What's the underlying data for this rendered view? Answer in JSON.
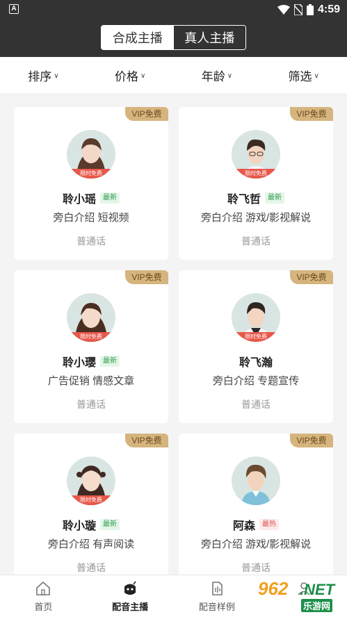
{
  "statusbar": {
    "time": "4:59"
  },
  "header": {
    "tabs": [
      {
        "label": "合成主播",
        "selected": true
      },
      {
        "label": "真人主播",
        "selected": false
      }
    ]
  },
  "filters": [
    {
      "label": "排序"
    },
    {
      "label": "价格"
    },
    {
      "label": "年龄"
    },
    {
      "label": "筛选"
    }
  ],
  "cards": [
    {
      "vip": "VIP免费",
      "avatar_tag": "限时免费",
      "name": "聆小瑶",
      "badge": "最新",
      "badge_type": "new",
      "tags": "旁白介绍 短视频",
      "lang": "普通话"
    },
    {
      "vip": "VIP免费",
      "avatar_tag": "限时免费",
      "name": "聆飞哲",
      "badge": "最新",
      "badge_type": "new",
      "tags": "旁白介绍 游戏/影视解说",
      "lang": "普通话"
    },
    {
      "vip": "VIP免费",
      "avatar_tag": "限时免费",
      "name": "聆小璎",
      "badge": "最新",
      "badge_type": "new",
      "tags": "广告促销 情感文章",
      "lang": "普通话"
    },
    {
      "vip": "VIP免费",
      "avatar_tag": "限时免费",
      "name": "聆飞瀚",
      "badge": "",
      "badge_type": "",
      "tags": "旁白介绍 专题宣传",
      "lang": "普通话"
    },
    {
      "vip": "VIP免费",
      "avatar_tag": "限时免费",
      "name": "聆小璇",
      "badge": "最新",
      "badge_type": "new",
      "tags": "旁白介绍 有声阅读",
      "lang": "普通话"
    },
    {
      "vip": "VIP免费",
      "avatar_tag": "",
      "name": "阿森",
      "badge": "最热",
      "badge_type": "hot",
      "tags": "旁白介绍 游戏/影视解说",
      "lang": "普通话"
    }
  ],
  "bottomnav": [
    {
      "label": "首页",
      "icon": "home-icon",
      "active": false
    },
    {
      "label": "配音主播",
      "icon": "anchor-icon",
      "active": true
    },
    {
      "label": "配音样例",
      "icon": "sample-file-icon",
      "active": false
    },
    {
      "label": "",
      "icon": "profile-icon",
      "active": false
    }
  ],
  "watermark": {
    "num": "962",
    "net": ".NET",
    "sub": "乐游网"
  },
  "colors": {
    "header_bg": "#333333",
    "vip_gold": "#d6b47e",
    "tag_red": "#e8584a",
    "new_green": "#2f9d4d",
    "hot_red": "#e24d4d"
  }
}
